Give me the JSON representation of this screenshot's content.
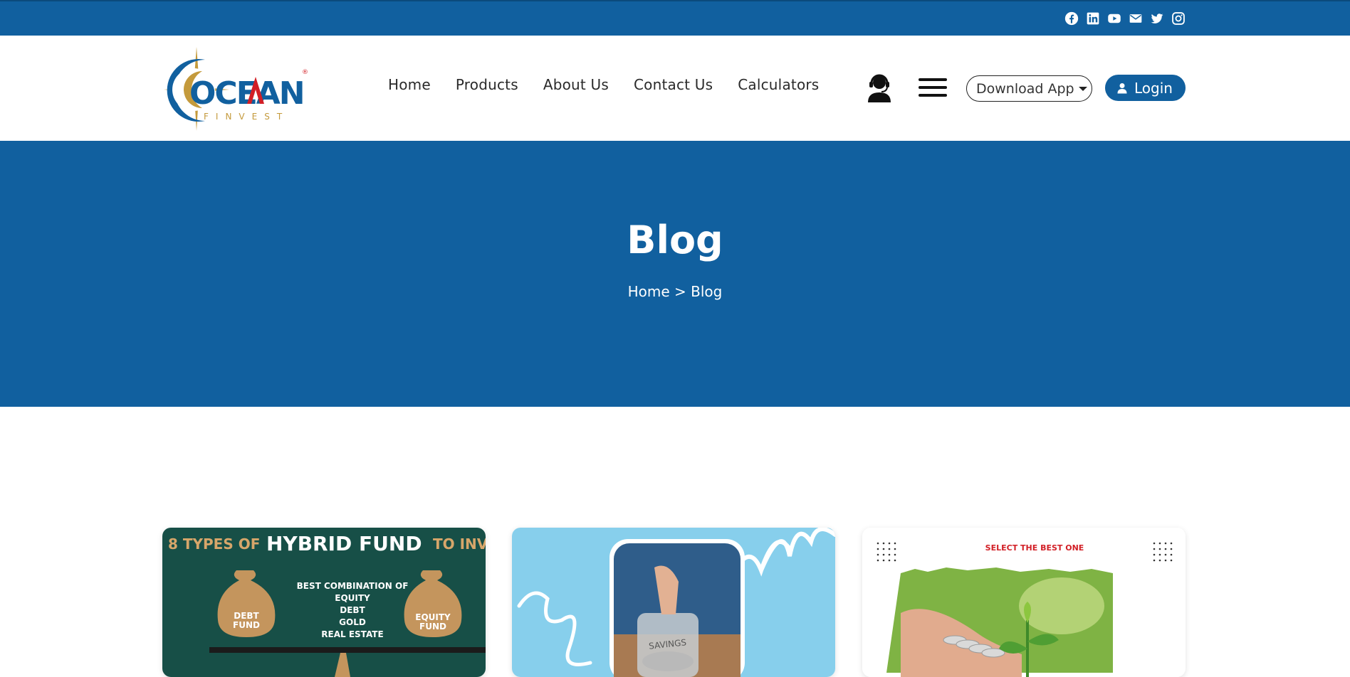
{
  "topbar": {
    "social_icons": [
      "facebook-icon",
      "linkedin-icon",
      "youtube-icon",
      "mail-icon",
      "twitter-icon",
      "instagram-icon"
    ]
  },
  "brand": {
    "name": "OCEAN",
    "tagline": "FINVEST",
    "registered": "®",
    "colors": {
      "blue": "#11609f",
      "red": "#d21f26",
      "gold": "#c49a3c"
    }
  },
  "nav": {
    "items": [
      "Home",
      "Products",
      "About Us",
      "Contact Us",
      "Calculators"
    ]
  },
  "header_actions": {
    "support_icon": "customer-support-icon",
    "menu_icon": "hamburger-menu-icon",
    "download_label": "Download App",
    "login_label": "Login"
  },
  "hero": {
    "title": "Blog",
    "breadcrumb": {
      "home": "Home",
      "separator": ">",
      "current": "Blog"
    }
  },
  "cards": [
    {
      "heading_prefix": "8 TYPES OF",
      "heading_main": "HYBRID FUND",
      "heading_suffix": "TO INV",
      "left_bag": [
        "DEBT",
        "FUND"
      ],
      "right_bag": [
        "EQUITY",
        "FUND"
      ],
      "center_lines": [
        "BEST COMBINATION OF",
        "EQUITY",
        "DEBT",
        "GOLD",
        "REAL ESTATE"
      ]
    },
    {
      "jar_label": "SAVINGS"
    },
    {
      "heading": "SELECT THE BEST ONE"
    }
  ]
}
